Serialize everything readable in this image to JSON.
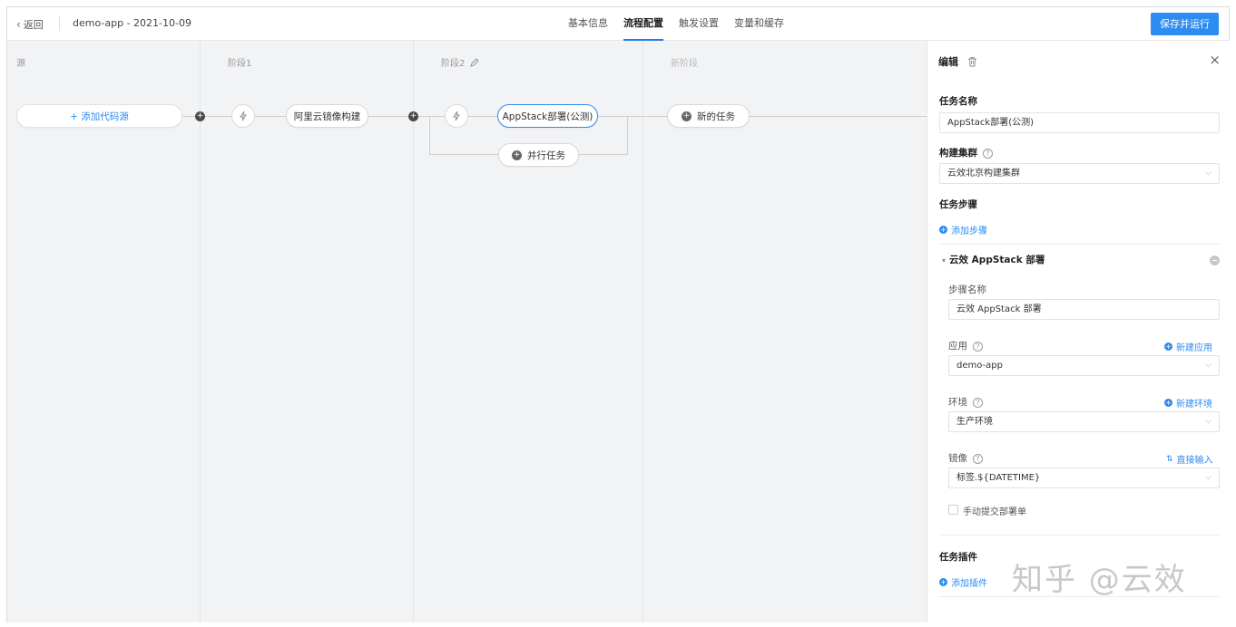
{
  "header": {
    "back_label": "返回",
    "app_title": "demo-app - 2021-10-09",
    "tabs": [
      "基本信息",
      "流程配置",
      "触发设置",
      "变量和缓存"
    ],
    "active_tab": "流程配置",
    "save_label": "保存并运行",
    "accent_color": "#2d8cf0"
  },
  "canvas": {
    "columns": {
      "source": "源",
      "stage1": "阶段1",
      "stage2": "阶段2",
      "new_stage": "新阶段"
    },
    "add_source_label": "+ 添加代码源",
    "stage1_task": "阿里云镜像构建",
    "stage2_task": "AppStack部署(公测)",
    "parallel_task": "并行任务",
    "new_task": "新的任务"
  },
  "panel": {
    "title": "编辑",
    "task_name_label": "任务名称",
    "task_name_value": "AppStack部署(公测)",
    "cluster_label": "构建集群",
    "cluster_value": "云效北京构建集群",
    "steps_label": "任务步骤",
    "add_step": "添加步骤",
    "step_title": "云效 AppStack 部署",
    "step_name_label": "步骤名称",
    "step_name_value": "云效 AppStack 部署",
    "app_label": "应用",
    "new_app": "新建应用",
    "app_value": "demo-app",
    "env_label": "环境",
    "new_env": "新建环境",
    "env_value": "生产环境",
    "image_label": "镜像",
    "direct_input": "直接输入",
    "image_value": "标签.${DATETIME}",
    "manual_submit": "手动提交部署单",
    "plugins_label": "任务插件",
    "add_plugin": "添加插件"
  },
  "watermark": "知乎 @云效"
}
